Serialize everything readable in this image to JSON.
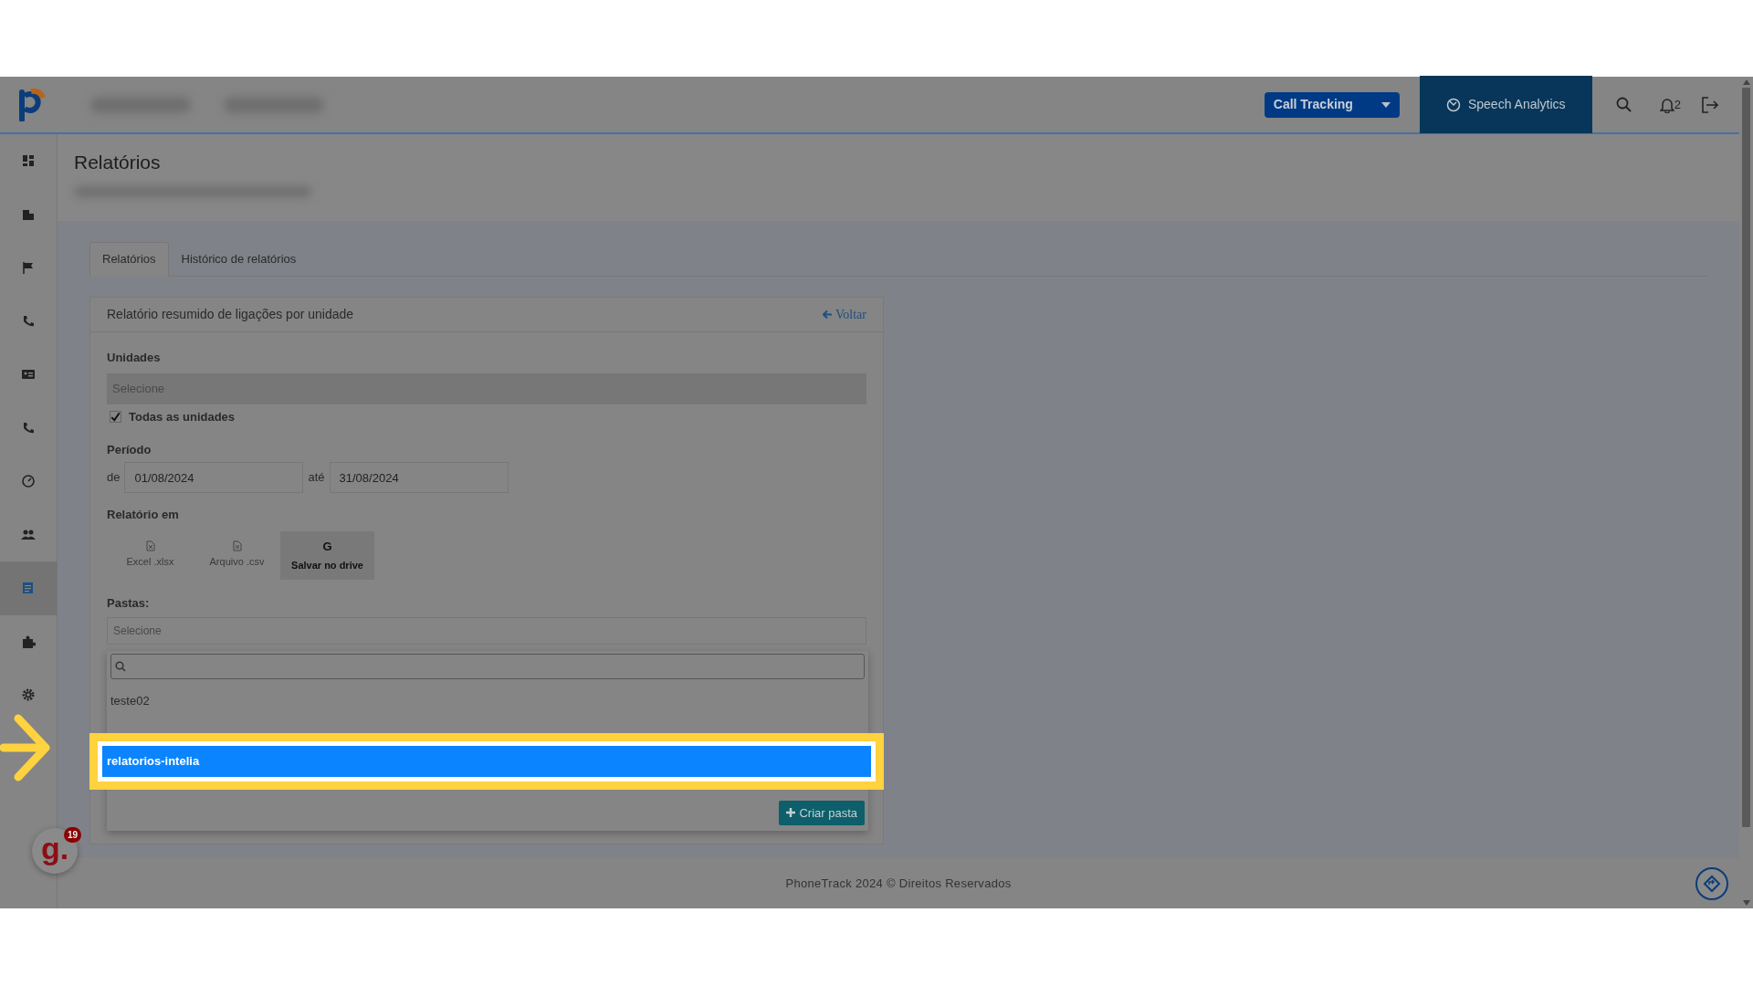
{
  "topbar": {
    "product_dropdown": {
      "label": "Call Tracking"
    },
    "speech_analytics": {
      "label": "Speech Analytics"
    },
    "notifications": {
      "count": "2"
    }
  },
  "sidebar": {
    "items": [
      {
        "selected": false
      },
      {
        "selected": false
      },
      {
        "selected": false
      },
      {
        "selected": false
      },
      {
        "selected": false
      },
      {
        "selected": false
      },
      {
        "selected": false
      },
      {
        "selected": false
      },
      {
        "selected": true
      },
      {
        "selected": false
      },
      {
        "selected": false
      }
    ]
  },
  "page": {
    "title": "Relatórios"
  },
  "tabs": [
    {
      "label": "Relatórios",
      "selected": true
    },
    {
      "label": "Histórico de relatórios",
      "selected": false
    }
  ],
  "card": {
    "title": "Relatório resumido de ligações por unidade",
    "back_link": "Voltar",
    "units": {
      "label": "Unidades",
      "placeholder": "Selecione",
      "all_label": "Todas as unidades",
      "all_checked": true
    },
    "period": {
      "label": "Período",
      "from_label": "de",
      "from": "01/08/2024",
      "to_label": "até",
      "to": "31/08/2024"
    },
    "format": {
      "label": "Relatório em",
      "options": [
        {
          "kind": "excel",
          "label": "Excel .xlsx",
          "selected": false
        },
        {
          "kind": "csv",
          "label": "Arquivo .csv",
          "selected": false
        },
        {
          "kind": "drive",
          "glyph": "G",
          "label": "Salvar no drive",
          "selected": true
        }
      ]
    },
    "folders": {
      "label": "Pastas:",
      "placeholder": "Selecione",
      "dropdown": {
        "options": [
          {
            "label": "teste02",
            "selected": false
          },
          {
            "label": "relatorios-intelia",
            "selected": true
          }
        ],
        "create_button": "Criar pasta"
      }
    }
  },
  "footer": {
    "text": "PhoneTrack 2024 © Direitos Reservados"
  },
  "chat_widget": {
    "logo": "g.",
    "badge": "19"
  }
}
